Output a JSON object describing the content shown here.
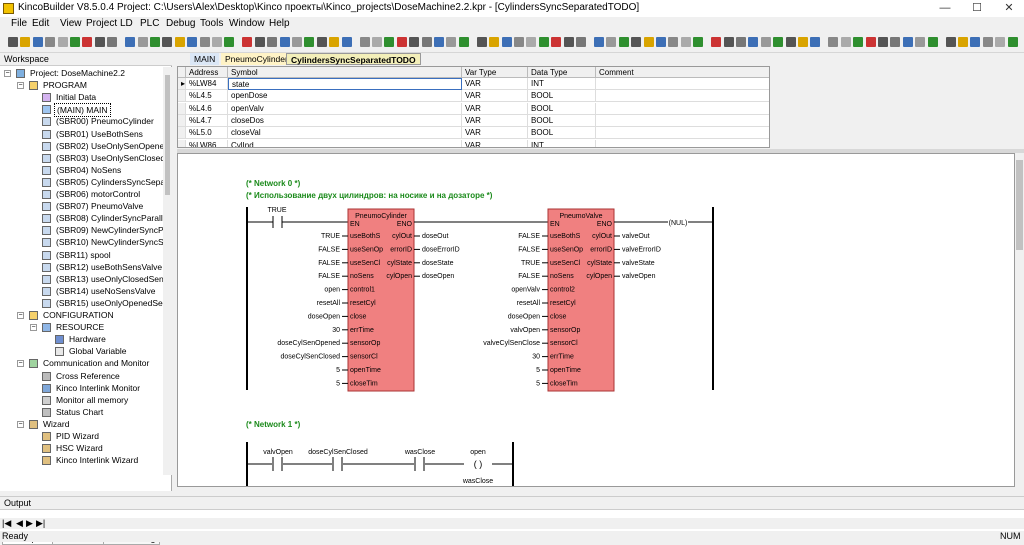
{
  "window": {
    "title": "KincoBuilder V8.5.0.4   Project: C:\\Users\\Alex\\Desktop\\Kinco проекты\\Kinco_projects\\DoseMachine2.2.kpr - [CylindersSyncSeparatedTODO]",
    "minimize": "—",
    "maximize": "☐",
    "close": "✕"
  },
  "menu": [
    "File",
    "Edit",
    "View",
    "Project",
    "LD",
    "PLC",
    "Debug",
    "Tools",
    "Window",
    "Help"
  ],
  "workspace": {
    "header": "Workspace",
    "tabs": [
      "Workspace",
      "Instructions",
      "HW Catalog"
    ],
    "tree": [
      {
        "label": "Project: DoseMachine2.2",
        "level": 0,
        "icon": "project-icon",
        "expand": "−"
      },
      {
        "label": "PROGRAM",
        "level": 1,
        "icon": "folder-icon",
        "expand": "−"
      },
      {
        "label": "Initial Data",
        "level": 2,
        "icon": "data-icon"
      },
      {
        "label": "(MAIN)  MAIN",
        "level": 2,
        "icon": "main-program-icon",
        "selected": true
      },
      {
        "label": "(SBR00)  PneumoCylinder",
        "level": 2,
        "icon": "subroutine-icon"
      },
      {
        "label": "(SBR01)  UseBothSens",
        "level": 2,
        "icon": "subroutine-icon"
      },
      {
        "label": "(SBR02)  UseOnlySenOpened",
        "level": 2,
        "icon": "subroutine-icon"
      },
      {
        "label": "(SBR03)  UseOnlySenClosed",
        "level": 2,
        "icon": "subroutine-icon"
      },
      {
        "label": "(SBR04)  NoSens",
        "level": 2,
        "icon": "subroutine-icon"
      },
      {
        "label": "(SBR05)  CylindersSyncSeparat",
        "level": 2,
        "icon": "subroutine-icon"
      },
      {
        "label": "(SBR06)  motorControl",
        "level": 2,
        "icon": "subroutine-icon"
      },
      {
        "label": "(SBR07)  PneumoValve",
        "level": 2,
        "icon": "subroutine-icon"
      },
      {
        "label": "(SBR08)  CylinderSyncParallele",
        "level": 2,
        "icon": "subroutine-icon"
      },
      {
        "label": "(SBR09)  NewCylinderSyncPara",
        "level": 2,
        "icon": "subroutine-icon"
      },
      {
        "label": "(SBR10)  NewCylinderSyncSep",
        "level": 2,
        "icon": "subroutine-icon"
      },
      {
        "label": "(SBR11)  spool",
        "level": 2,
        "icon": "subroutine-icon"
      },
      {
        "label": "(SBR12)  useBothSensValve",
        "level": 2,
        "icon": "subroutine-icon"
      },
      {
        "label": "(SBR13)  useOnlyClosedSenVa",
        "level": 2,
        "icon": "subroutine-icon"
      },
      {
        "label": "(SBR14)  useNoSensValve",
        "level": 2,
        "icon": "subroutine-icon"
      },
      {
        "label": "(SBR15)  useOnlyOpenedSenV",
        "level": 2,
        "icon": "subroutine-icon"
      },
      {
        "label": "CONFIGURATION",
        "level": 1,
        "icon": "config-icon",
        "expand": "−"
      },
      {
        "label": "RESOURCE",
        "level": 2,
        "icon": "resource-icon",
        "expand": "−"
      },
      {
        "label": "Hardware",
        "level": 3,
        "icon": "hardware-icon"
      },
      {
        "label": "Global Variable",
        "level": 3,
        "icon": "variable-icon"
      },
      {
        "label": "Communication and Monitor",
        "level": 1,
        "icon": "monitor-icon",
        "expand": "−"
      },
      {
        "label": "Cross Reference",
        "level": 2,
        "icon": "cross-ref-icon"
      },
      {
        "label": "Kinco Interlink Monitor",
        "level": 2,
        "icon": "interlink-icon"
      },
      {
        "label": "Monitor all memory",
        "level": 2,
        "icon": "memory-icon"
      },
      {
        "label": "Status Chart",
        "level": 2,
        "icon": "chart-icon"
      },
      {
        "label": "Wizard",
        "level": 1,
        "icon": "wizard-icon",
        "expand": "−"
      },
      {
        "label": "PID Wizard",
        "level": 2,
        "icon": "wizard-icon"
      },
      {
        "label": "HSC Wizard",
        "level": 2,
        "icon": "wizard-icon"
      },
      {
        "label": "Kinco Interlink Wizard",
        "level": 2,
        "icon": "wizard-icon"
      }
    ]
  },
  "doc_tabs": [
    {
      "label": "MAIN",
      "bg": "#dbe7f6"
    },
    {
      "label": "PneumoCylinder",
      "bg": "#fff3c6"
    },
    {
      "label": "CylindersSyncSeparatedTODO",
      "bg": "#f3efb9",
      "active": true
    }
  ],
  "var_table": {
    "headers": [
      "Address",
      "Symbol",
      "Var Type",
      "Data Type",
      "Comment"
    ],
    "rows": [
      {
        "marker": "▸",
        "address": "%LW84",
        "symbol": "state",
        "var_type": "VAR",
        "data_type": "INT"
      },
      {
        "marker": "",
        "address": "%L4.5",
        "symbol": "openDose",
        "var_type": "VAR",
        "data_type": "BOOL"
      },
      {
        "marker": "",
        "address": "%L4.6",
        "symbol": "openValv",
        "var_type": "VAR",
        "data_type": "BOOL"
      },
      {
        "marker": "",
        "address": "%L4.7",
        "symbol": "closeDos",
        "var_type": "VAR",
        "data_type": "BOOL"
      },
      {
        "marker": "",
        "address": "%L5.0",
        "symbol": "closeVal",
        "var_type": "VAR",
        "data_type": "BOOL"
      },
      {
        "marker": "",
        "address": "%LW86",
        "symbol": "CylInd",
        "var_type": "VAR",
        "data_type": "INT"
      }
    ]
  },
  "ladder": {
    "net0_comment": "(* Network 0 *)",
    "net0_desc": "(* Использование двух цилиндров: на носике и на дозаторе *)",
    "net1_comment": "(* Network 1 *)",
    "contact_true": "TRUE",
    "coil": "(NUL)",
    "fb1": {
      "name": "PneumoCylinder",
      "en": "EN",
      "eno": "ENO",
      "inputs": [
        "useBothS",
        "useSenOp",
        "useSenCl",
        "noSens",
        "control1",
        "resetCyl",
        "close",
        "errTime",
        "sensorOp",
        "sensorCl",
        "openTime",
        "closeTim"
      ],
      "input_vals": [
        "TRUE",
        "FALSE",
        "FALSE",
        "FALSE",
        "open",
        "resetAll",
        "doseOpen",
        "30",
        "doseCylSenOpened",
        "doseCylSenClosed",
        "5",
        "5"
      ],
      "outputs": [
        "cylOut",
        "errorID",
        "cylState",
        "cylOpen"
      ],
      "output_vals": [
        "doseOut",
        "doseErrorID",
        "doseState",
        "doseOpen"
      ]
    },
    "fb2": {
      "name": "PneumoValve",
      "en": "EN",
      "eno": "ENO",
      "inputs": [
        "useBothS",
        "useSenOp",
        "useSenCl",
        "noSens",
        "control2",
        "resetCyl",
        "close",
        "sensorOp",
        "sensorCl",
        "errTime",
        "openTime",
        "closeTim"
      ],
      "input_vals": [
        "FALSE",
        "FALSE",
        "TRUE",
        "FALSE",
        "openValv",
        "resetAll",
        "doseOpen",
        "valvOpen",
        "valveCylSenClose",
        "30",
        "5",
        "5"
      ],
      "outputs": [
        "cylOut",
        "errorID",
        "cylState",
        "cylOpen"
      ],
      "output_vals": [
        "valveOut",
        "valveErrorID",
        "valveState",
        "valveOpen"
      ]
    },
    "net1_contacts": [
      "valvOpen",
      "doseCylSenClosed",
      "wasClose"
    ],
    "net1_coil": "open",
    "net1_partial": "wasClose"
  },
  "output_panel": {
    "title": "Output"
  },
  "status": {
    "left": "Ready",
    "right": "NUM"
  }
}
